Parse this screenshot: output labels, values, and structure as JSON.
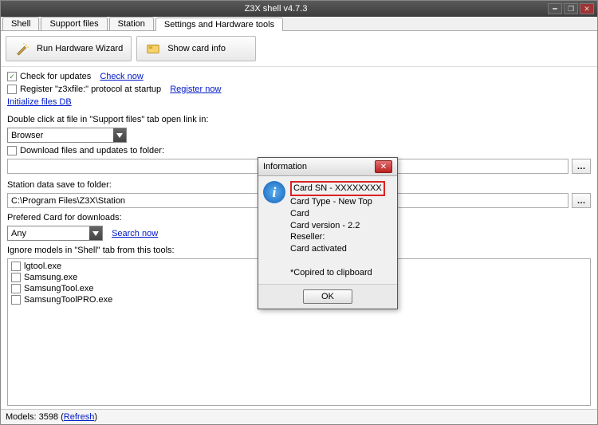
{
  "window": {
    "title": "Z3X shell v4.7.3"
  },
  "tabs": [
    "Shell",
    "Support files",
    "Station",
    "Settings and Hardware tools"
  ],
  "active_tab": 3,
  "toolbar": {
    "wizard_label": "Run Hardware Wizard",
    "cardinfo_label": "Show card info"
  },
  "settings": {
    "check_updates_checked": true,
    "check_updates_label": "Check for updates",
    "check_now_link": "Check now",
    "register_protocol_checked": false,
    "register_protocol_label": "Register \"z3xfile:\" protocol at startup",
    "register_now_link": "Register now",
    "init_files_link": "Initialize files DB",
    "double_click_label": "Double click at file in \"Support files\" tab open link in:",
    "open_in_value": "Browser",
    "download_folder_checked": false,
    "download_folder_label": "Download files and updates to folder:",
    "download_folder_value": "",
    "station_save_label": "Station data save to folder:",
    "station_save_value": "C:\\Program Files\\Z3X\\Station",
    "prefered_card_label": "Prefered Card for downloads:",
    "prefered_card_value": "Any",
    "search_now_link": "Search now",
    "ignore_label": "Ignore models in \"Shell\" tab from this tools:",
    "ignore_items": [
      "lgtool.exe",
      "Samsung.exe",
      "SamsungTool.exe",
      "SamsungToolPRO.exe"
    ]
  },
  "statusbar": {
    "models_label": "Models: ",
    "models_count": "3598",
    "refresh_label": "Refresh"
  },
  "modal": {
    "title": "Information",
    "line1": "Card SN - XXXXXXXX",
    "line2": "Card Type - New Top Card",
    "line3": "Card version - 2.2",
    "line4": "Reseller:",
    "line5": "Card activated",
    "line6": "*Copired to clipboard",
    "ok": "OK"
  }
}
